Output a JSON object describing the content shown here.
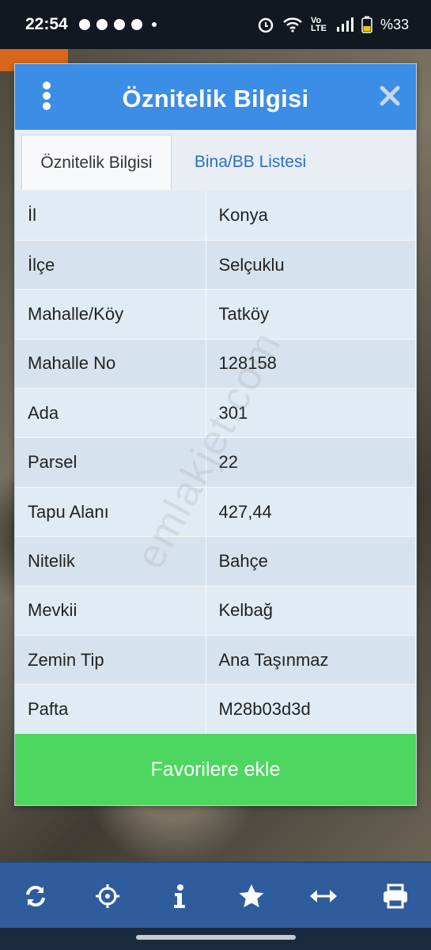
{
  "status_bar": {
    "time": "22:54",
    "network": "Vo LTE",
    "battery": "%33"
  },
  "dialog": {
    "title": "Öznitelik Bilgisi",
    "tabs": [
      {
        "label": "Öznitelik Bilgisi",
        "active": true
      },
      {
        "label": "Bina/BB Listesi",
        "active": false
      }
    ],
    "rows": [
      {
        "key": "İl",
        "value": "Konya"
      },
      {
        "key": "İlçe",
        "value": "Selçuklu"
      },
      {
        "key": "Mahalle/Köy",
        "value": "Tatköy"
      },
      {
        "key": "Mahalle No",
        "value": "128158"
      },
      {
        "key": "Ada",
        "value": "301"
      },
      {
        "key": "Parsel",
        "value": "22"
      },
      {
        "key": "Tapu Alanı",
        "value": "427,44"
      },
      {
        "key": "Nitelik",
        "value": "Bahçe"
      },
      {
        "key": "Mevkii",
        "value": "Kelbağ"
      },
      {
        "key": "Zemin Tip",
        "value": "Ana Taşınmaz"
      },
      {
        "key": "Pafta",
        "value": "M28b03d3d"
      }
    ],
    "favorite_button": "Favorilere ekle"
  },
  "watermark": "emlakjet.com",
  "toolbar": {
    "tools": [
      "refresh-icon",
      "crosshair-icon",
      "info-icon",
      "star-icon",
      "horizontal-arrows-icon",
      "printer-icon"
    ]
  },
  "colors": {
    "header": "#3b8de6",
    "button": "#4dd660",
    "toolbar": "#2f5c9c",
    "tab_link": "#2c6fbf"
  }
}
